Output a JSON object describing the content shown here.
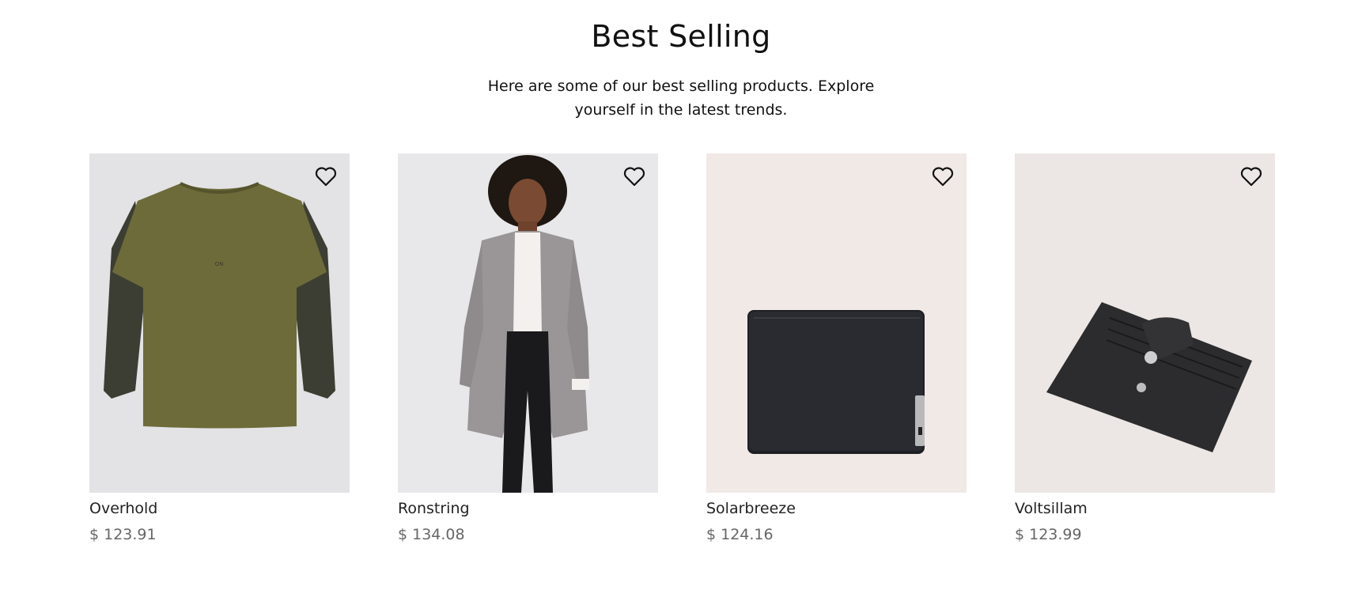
{
  "section": {
    "title": "Best Selling",
    "subtitle": "Here are some of our best selling products. Explore yourself in the latest trends."
  },
  "products": [
    {
      "name": "Overhold",
      "price": "$ 123.91",
      "image": "olive-layered-tshirt",
      "bg": "#e3e3e6"
    },
    {
      "name": "Ronstring",
      "price": "$ 134.08",
      "image": "woman-grey-coat",
      "bg": "#e8e8ea"
    },
    {
      "name": "Solarbreeze",
      "price": "$ 124.16",
      "image": "black-bifold-wallet",
      "bg": "#f1e9e6"
    },
    {
      "name": "Voltsillam",
      "price": "$ 123.99",
      "image": "black-card-holder",
      "bg": "#ece7e4"
    }
  ],
  "icons": {
    "favorite": "heart-outline-icon"
  }
}
